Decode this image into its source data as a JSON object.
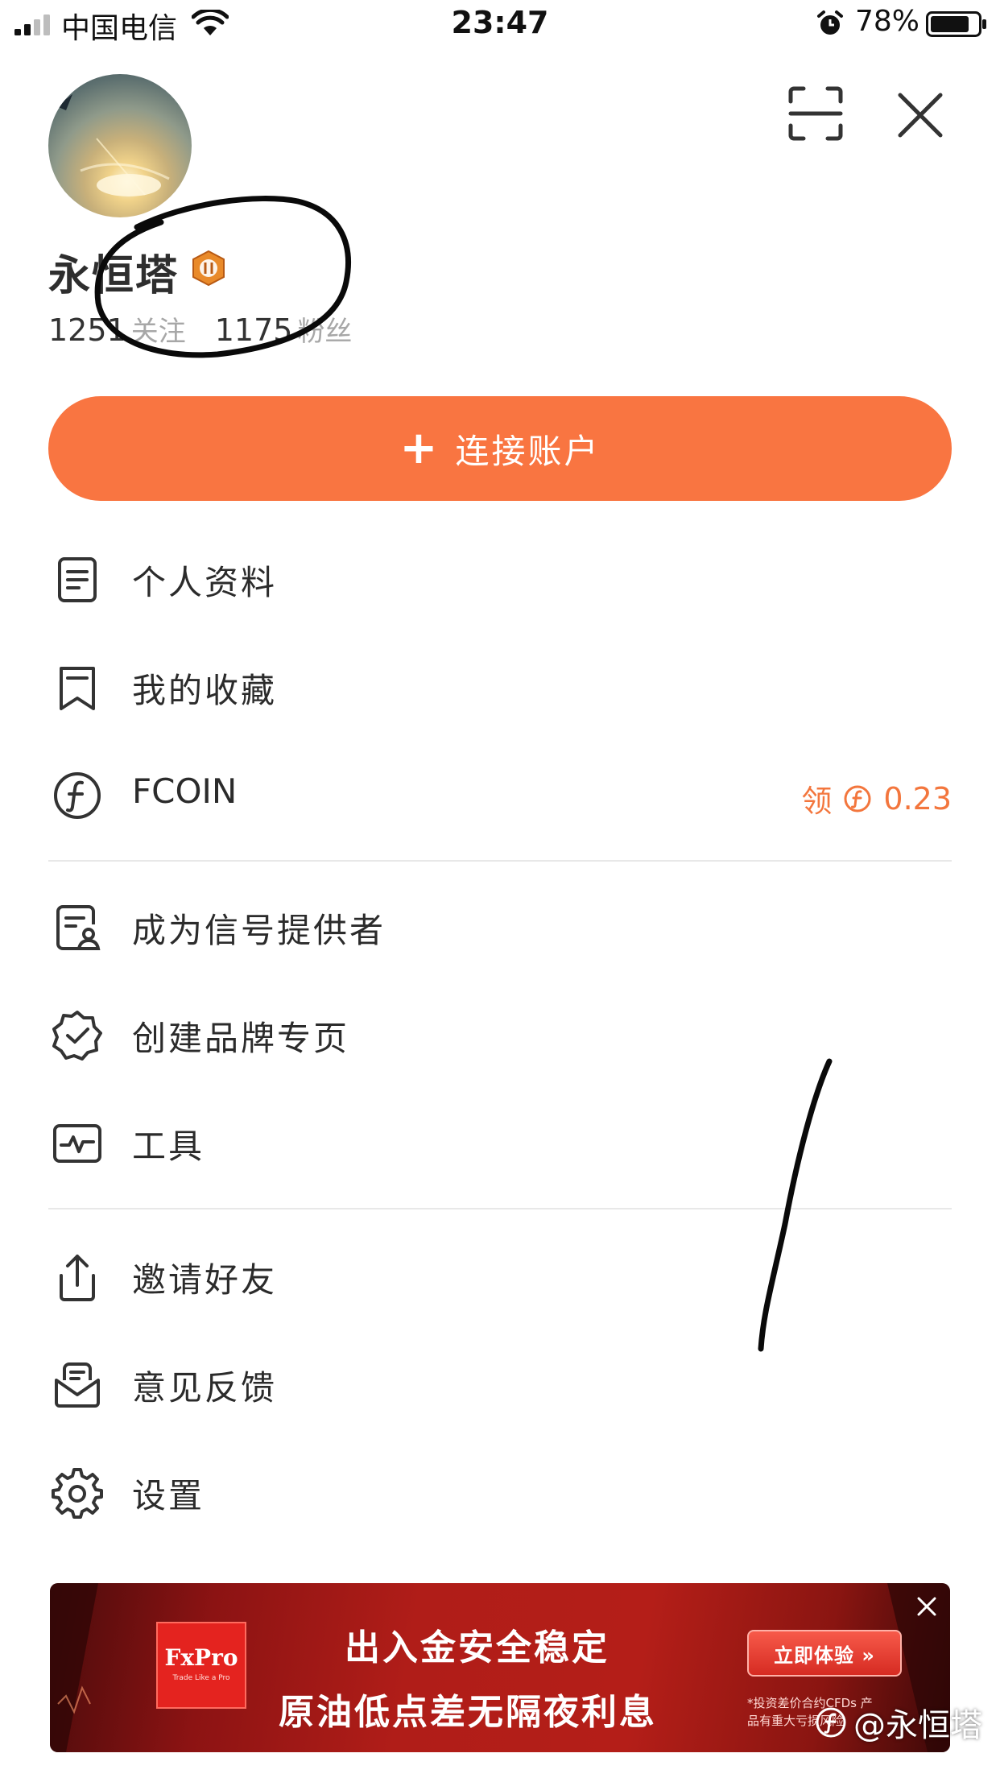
{
  "status_bar": {
    "carrier": "中国电信",
    "time": "23:47",
    "battery": "78%",
    "battery_level": 0.78
  },
  "profile": {
    "username": "永恒塔",
    "following_count": "1251",
    "following_label": "关注",
    "followers_count": "1175",
    "followers_label": "粉丝"
  },
  "connect_button": {
    "label": "连接账户"
  },
  "menu": {
    "profile_info": "个人资料",
    "favorites": "我的收藏",
    "fcoin": "FCOIN",
    "fcoin_claim": "领",
    "fcoin_value": "0.23",
    "signal_provider": "成为信号提供者",
    "brand_page": "创建品牌专页",
    "tools": "工具",
    "invite": "邀请好友",
    "feedback": "意见反馈",
    "settings": "设置"
  },
  "ad": {
    "brand": "FxPro",
    "brand_tagline": "Trade Like a Pro",
    "line1": "出入金安全稳定",
    "line2": "原油低点差无隔夜利息",
    "cta": "立即体验 »",
    "disclaimer": "*投资差价合约CFDs 产品有重大亏损风险"
  },
  "watermark": "@永恒塔",
  "colors": {
    "accent": "#f97541",
    "coin": "#f3763d",
    "ad_red": "#b01d18"
  }
}
